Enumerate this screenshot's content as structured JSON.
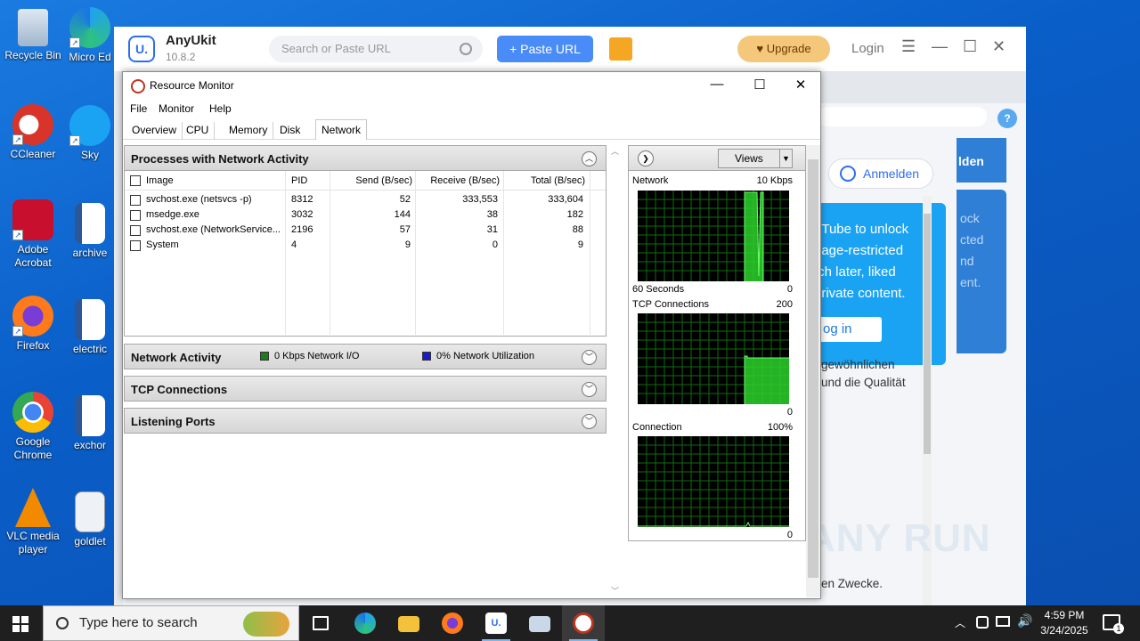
{
  "desktop": {
    "icons": [
      {
        "label": "Recycle Bin",
        "name": "recycle-bin-icon"
      },
      {
        "label": "CCleaner",
        "name": "ccleaner-icon"
      },
      {
        "label": "Adobe Acrobat",
        "name": "adobe-acrobat-icon"
      },
      {
        "label": "Firefox",
        "name": "firefox-icon"
      },
      {
        "label": "Google Chrome",
        "name": "chrome-icon"
      },
      {
        "label": "VLC media player",
        "name": "vlc-icon"
      }
    ],
    "icons_col2": [
      {
        "label": "Micro Ed",
        "name": "edge-icon"
      },
      {
        "label": "Sky",
        "name": "skype-icon"
      },
      {
        "label": "archive",
        "name": "word-doc-icon"
      },
      {
        "label": "electric",
        "name": "word-doc-icon"
      },
      {
        "label": "exchor",
        "name": "word-doc-icon"
      },
      {
        "label": "goldlet",
        "name": "image-file-icon"
      }
    ]
  },
  "anyukit": {
    "name": "AnyUkit",
    "version": "10.8.2",
    "logo": "U.",
    "search_placeholder": "Search or Paste URL",
    "paste_label": "+ Paste URL",
    "upgrade_label": "Upgrade",
    "login_label": "Login",
    "anmelden_label": "Anmelden",
    "popup_lines": [
      "uTube to unlock",
      "f age-restricted",
      "tch later, liked",
      "private content."
    ],
    "popup_login": "og in",
    "bluecard_lines": [
      "ock",
      "cted",
      "nd",
      "ent."
    ],
    "bluetop": "lden",
    "de_lines": [
      "gewöhnlichen",
      "und die Qualität"
    ],
    "de_bottom": "en Zwecke.",
    "help": "?"
  },
  "resmon": {
    "title": "Resource Monitor",
    "menu": [
      "File",
      "Monitor",
      "Help"
    ],
    "tabs": [
      "Overview",
      "CPU",
      "Memory",
      "Disk",
      "Network"
    ],
    "active_tab": "Network",
    "processes": {
      "title": "Processes with Network Activity",
      "columns": [
        "Image",
        "PID",
        "Send (B/sec)",
        "Receive (B/sec)",
        "Total (B/sec)"
      ],
      "rows": [
        [
          "svchost.exe (netsvcs -p)",
          "8312",
          "52",
          "333,553",
          "333,604"
        ],
        [
          "msedge.exe",
          "3032",
          "144",
          "38",
          "182"
        ],
        [
          "svchost.exe (NetworkService...",
          "2196",
          "57",
          "31",
          "88"
        ],
        [
          "System",
          "4",
          "9",
          "0",
          "9"
        ]
      ]
    },
    "network_activity": {
      "title": "Network Activity",
      "io_label": "0 Kbps Network I/O",
      "util_label": "0% Network Utilization",
      "io_color": "#1f7a1f",
      "util_color": "#1a1ac8"
    },
    "tcp_title": "TCP Connections",
    "ports_title": "Listening Ports",
    "views_label": "Views",
    "graphs": [
      {
        "title": "Network",
        "max": "10 Kbps",
        "footer_left": "60 Seconds",
        "footer_right": "0"
      },
      {
        "title": "TCP Connections",
        "max": "200",
        "footer_left": "",
        "footer_right": "0"
      },
      {
        "title": "Connection",
        "max": "100%",
        "footer_left": "",
        "footer_right": "0"
      }
    ]
  },
  "taskbar": {
    "search_placeholder": "Type here to search",
    "time": "4:59 PM",
    "date": "3/24/2025",
    "notification_count": "1"
  },
  "watermark": "ANY RUN"
}
